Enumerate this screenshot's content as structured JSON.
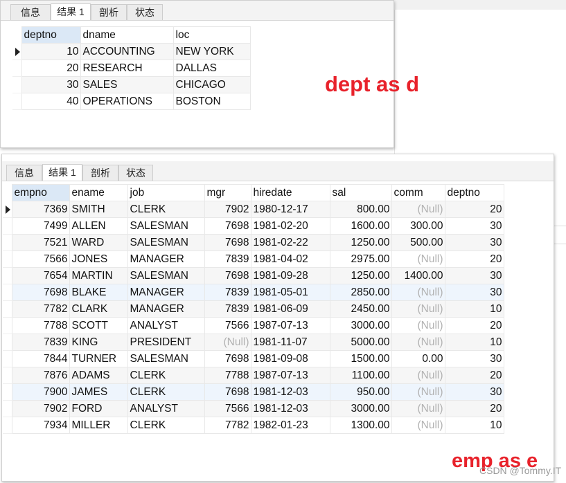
{
  "tabs": [
    "信息",
    "结果 1",
    "剖析",
    "状态"
  ],
  "dept": {
    "columns": [
      "deptno",
      "dname",
      "loc"
    ],
    "rows": [
      [
        "10",
        "ACCOUNTING",
        "NEW YORK"
      ],
      [
        "20",
        "RESEARCH",
        "DALLAS"
      ],
      [
        "30",
        "SALES",
        "CHICAGO"
      ],
      [
        "40",
        "OPERATIONS",
        "BOSTON"
      ]
    ]
  },
  "emp": {
    "columns": [
      "empno",
      "ename",
      "job",
      "mgr",
      "hiredate",
      "sal",
      "comm",
      "deptno"
    ],
    "rows": [
      [
        "7369",
        "SMITH",
        "CLERK",
        "7902",
        "1980-12-17",
        "800.00",
        "(Null)",
        "20"
      ],
      [
        "7499",
        "ALLEN",
        "SALESMAN",
        "7698",
        "1981-02-20",
        "1600.00",
        "300.00",
        "30"
      ],
      [
        "7521",
        "WARD",
        "SALESMAN",
        "7698",
        "1981-02-22",
        "1250.00",
        "500.00",
        "30"
      ],
      [
        "7566",
        "JONES",
        "MANAGER",
        "7839",
        "1981-04-02",
        "2975.00",
        "(Null)",
        "20"
      ],
      [
        "7654",
        "MARTIN",
        "SALESMAN",
        "7698",
        "1981-09-28",
        "1250.00",
        "1400.00",
        "30"
      ],
      [
        "7698",
        "BLAKE",
        "MANAGER",
        "7839",
        "1981-05-01",
        "2850.00",
        "(Null)",
        "30"
      ],
      [
        "7782",
        "CLARK",
        "MANAGER",
        "7839",
        "1981-06-09",
        "2450.00",
        "(Null)",
        "10"
      ],
      [
        "7788",
        "SCOTT",
        "ANALYST",
        "7566",
        "1987-07-13",
        "3000.00",
        "(Null)",
        "20"
      ],
      [
        "7839",
        "KING",
        "PRESIDENT",
        "(Null)",
        "1981-11-07",
        "5000.00",
        "(Null)",
        "10"
      ],
      [
        "7844",
        "TURNER",
        "SALESMAN",
        "7698",
        "1981-09-08",
        "1500.00",
        "0.00",
        "30"
      ],
      [
        "7876",
        "ADAMS",
        "CLERK",
        "7788",
        "1987-07-13",
        "1100.00",
        "(Null)",
        "20"
      ],
      [
        "7900",
        "JAMES",
        "CLERK",
        "7698",
        "1981-12-03",
        "950.00",
        "(Null)",
        "30"
      ],
      [
        "7902",
        "FORD",
        "ANALYST",
        "7566",
        "1981-12-03",
        "3000.00",
        "(Null)",
        "20"
      ],
      [
        "7934",
        "MILLER",
        "CLERK",
        "7782",
        "1982-01-23",
        "1300.00",
        "(Null)",
        "10"
      ]
    ]
  },
  "annotations": {
    "dept_label": "dept as d",
    "emp_label": "emp as e",
    "watermark": "CSDN @Tommy.IT"
  },
  "colors": {
    "annotation": "#e8222b",
    "null_text": "#b2b2b2",
    "selected_header": "#dbe8f6"
  }
}
